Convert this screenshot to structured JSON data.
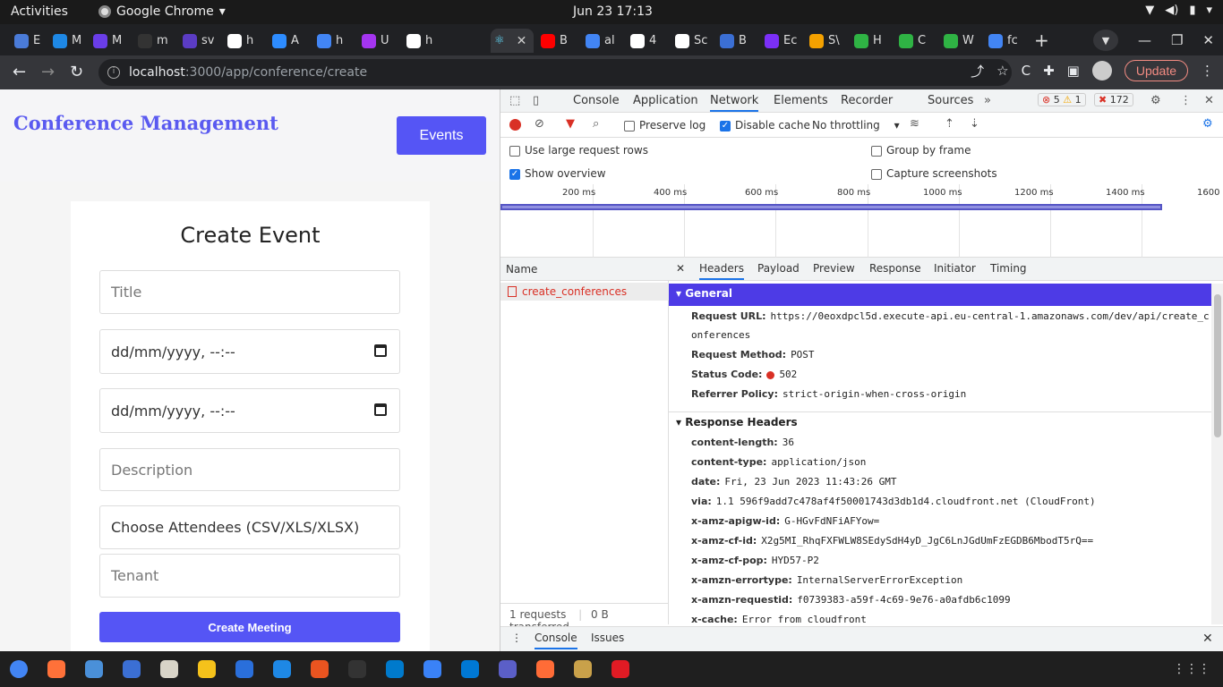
{
  "system": {
    "activities": "Activities",
    "app_name": "Google Chrome",
    "clock": "Jun 23  17:13"
  },
  "browser": {
    "tabs": [
      {
        "label": "E",
        "color": "#4a7bd8"
      },
      {
        "label": "M",
        "color": "#1e88e5"
      },
      {
        "label": "M",
        "color": "#6a3de8"
      },
      {
        "label": "m",
        "color": "#333333"
      },
      {
        "label": "sv",
        "color": "#5b3cc4"
      },
      {
        "label": "h",
        "color": "#ffffff"
      },
      {
        "label": "A",
        "color": "#2d8cff"
      },
      {
        "label": "h",
        "color": "#4285f4"
      },
      {
        "label": "U",
        "color": "#a435f0"
      },
      {
        "label": "h",
        "color": "#ffffff"
      },
      {
        "label": "B",
        "color": "#ff0000"
      },
      {
        "label": "al",
        "color": "#4285f4"
      },
      {
        "label": "4",
        "color": "#ffffff"
      },
      {
        "label": "Sc",
        "color": "#ffffff"
      },
      {
        "label": "B",
        "color": "#3b6fd4"
      },
      {
        "label": "Ec",
        "color": "#7b2ff7"
      },
      {
        "label": "S\\",
        "color": "#f4a100"
      },
      {
        "label": "H",
        "color": "#2fb344"
      },
      {
        "label": "C",
        "color": "#2fb344"
      },
      {
        "label": "W",
        "color": "#2fb344"
      },
      {
        "label": "fc",
        "color": "#4285f4"
      }
    ],
    "url_host": "localhost",
    "url_path": ":3000/app/conference/create",
    "update_label": "Update"
  },
  "page": {
    "brand": "Conference Management",
    "events_label": "Events",
    "form_title": "Create Event",
    "title_placeholder": "Title",
    "start_placeholder": "dd/mm/yyyy, --:--",
    "end_placeholder": "dd/mm/yyyy, --:--",
    "description_placeholder": "Description",
    "attendees_label": "Choose Attendees (CSV/XLS/XLSX)",
    "tenant_placeholder": "Tenant",
    "submit_label": "Create Meeting"
  },
  "devtools": {
    "tabs": [
      "Console",
      "Application",
      "Network",
      "Elements",
      "Recorder",
      "Sources"
    ],
    "active_tab": "Network",
    "errors": "5",
    "warnings": "1",
    "issues": "172",
    "preserve_log": "Preserve log",
    "disable_cache": "Disable cache",
    "throttling": "No throttling",
    "large_rows": "Use large request rows",
    "show_overview": "Show overview",
    "group_by_frame": "Group by frame",
    "capture_screenshots": "Capture screenshots",
    "overview_ticks": [
      "200 ms",
      "400 ms",
      "600 ms",
      "800 ms",
      "1000 ms",
      "1200 ms",
      "1400 ms",
      "1600"
    ],
    "name_header": "Name",
    "request_name": "create_conferences",
    "summary_requests": "1 requests",
    "summary_transferred": "0 B transferred",
    "detail_tabs": [
      "Headers",
      "Payload",
      "Preview",
      "Response",
      "Initiator",
      "Timing"
    ],
    "general_title": "General",
    "general": {
      "url_key": "Request URL:",
      "url_val_1": "https://0eoxdpcl5d.execute-api.eu-central-1.amazonaws.com/dev/api/create_c",
      "url_val_2": "onferences",
      "method_key": "Request Method:",
      "method_val": "POST",
      "status_key": "Status Code:",
      "status_val": "502",
      "referrer_key": "Referrer Policy:",
      "referrer_val": "strict-origin-when-cross-origin"
    },
    "response_title": "Response Headers",
    "response_headers": [
      {
        "k": "content-length:",
        "v": "36"
      },
      {
        "k": "content-type:",
        "v": "application/json"
      },
      {
        "k": "date:",
        "v": "Fri, 23 Jun 2023 11:43:26 GMT"
      },
      {
        "k": "via:",
        "v": "1.1 596f9add7c478af4f50001743d3db1d4.cloudfront.net (CloudFront)"
      },
      {
        "k": "x-amz-apigw-id:",
        "v": "G-HGvFdNFiAFYow="
      },
      {
        "k": "x-amz-cf-id:",
        "v": "X2g5MI_RhqFXFWLW8SEdySdH4yD_JgC6LnJGdUmFzEGDB6MbodT5rQ=="
      },
      {
        "k": "x-amz-cf-pop:",
        "v": "HYD57-P2"
      },
      {
        "k": "x-amzn-errortype:",
        "v": "InternalServerErrorException"
      },
      {
        "k": "x-amzn-requestid:",
        "v": "f0739383-a59f-4c69-9e76-a0afdb6c1099"
      },
      {
        "k": "x-cache:",
        "v": "Error from cloudfront"
      }
    ],
    "drawer_tabs": [
      "Console",
      "Issues"
    ]
  },
  "dock": {
    "apps": [
      "chrome-icon",
      "firefox-icon",
      "chromium-icon",
      "thunderbird-icon",
      "files-icon",
      "rhythmbox-icon",
      "writer-icon",
      "help-icon",
      "software-icon",
      "terminal-icon",
      "vscode-icon",
      "notes-icon",
      "outlook-icon",
      "teams-icon",
      "postman-icon",
      "archive-icon",
      "alert-icon"
    ],
    "colors": [
      "#4285f4",
      "#ff7139",
      "#4a90d9",
      "#3b6fd4",
      "#d8d4c8",
      "#f5c21b",
      "#2a6fdb",
      "#1e88e5",
      "#e95420",
      "#333333",
      "#007acc",
      "#3a82f7",
      "#0078d4",
      "#5b5fc7",
      "#ff6c37",
      "#c9a14a",
      "#e01b24"
    ]
  }
}
